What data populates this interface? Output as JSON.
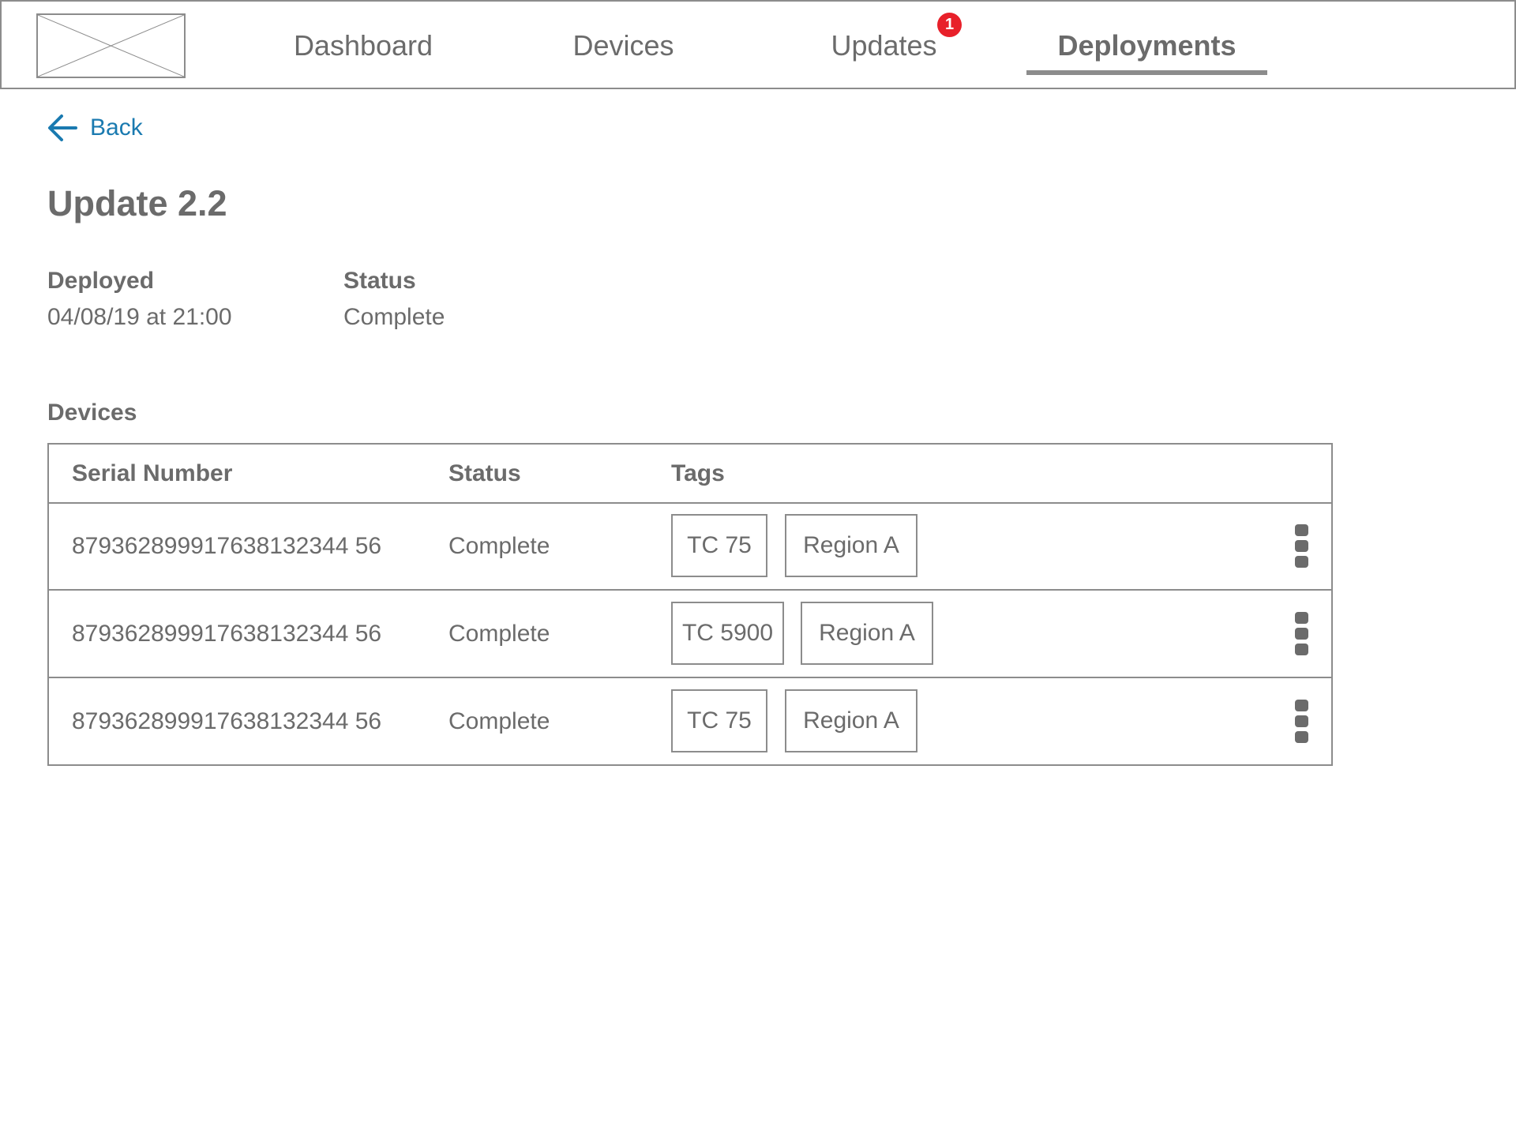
{
  "nav": {
    "logo_icon": "image-placeholder-icon",
    "tabs": [
      {
        "label": "Dashboard",
        "active": false
      },
      {
        "label": "Devices",
        "active": false
      },
      {
        "label": "Updates",
        "active": false,
        "badge": "1"
      },
      {
        "label": "Deployments",
        "active": true
      }
    ],
    "badge_color": "#e8202a"
  },
  "back": {
    "label": "Back",
    "icon": "arrow-left-icon",
    "color": "#1a7ab0"
  },
  "page": {
    "title": "Update 2.2",
    "deployed_label": "Deployed",
    "deployed_value": "04/08/19 at 21:00",
    "status_label": "Status",
    "status_value": "Complete",
    "devices_label": "Devices"
  },
  "table": {
    "headers": [
      "Serial Number",
      "Status",
      "Tags"
    ],
    "rows": [
      {
        "serial": "879362899917638132344 56",
        "status": "Complete",
        "tags": [
          "TC 75",
          "Region A"
        ]
      },
      {
        "serial": "879362899917638132344 56",
        "status": "Complete",
        "tags": [
          "TC 5900",
          "Region A"
        ]
      },
      {
        "serial": "879362899917638132344 56",
        "status": "Complete",
        "tags": [
          "TC 75",
          "Region A"
        ]
      }
    ],
    "row_menu_icon": "kebab-menu-icon"
  }
}
